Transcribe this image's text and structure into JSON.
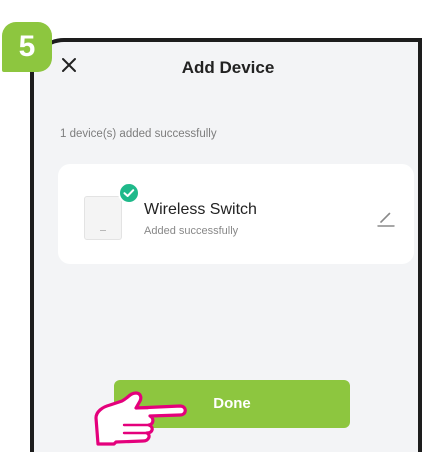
{
  "step": {
    "number": "5",
    "color": "#8dc63f"
  },
  "header": {
    "title": "Add Device",
    "close_icon": "close-icon"
  },
  "status_text": "1 device(s) added successfully",
  "device": {
    "name": "Wireless Switch",
    "status": "Added successfully",
    "badge_icon": "check-circle-icon",
    "badge_color": "#1fb98a",
    "edit_icon": "pencil-icon"
  },
  "actions": {
    "done_label": "Done",
    "done_color": "#8dc63f"
  },
  "pointer": {
    "icon": "pointing-hand-icon",
    "color": "#e4007c"
  }
}
